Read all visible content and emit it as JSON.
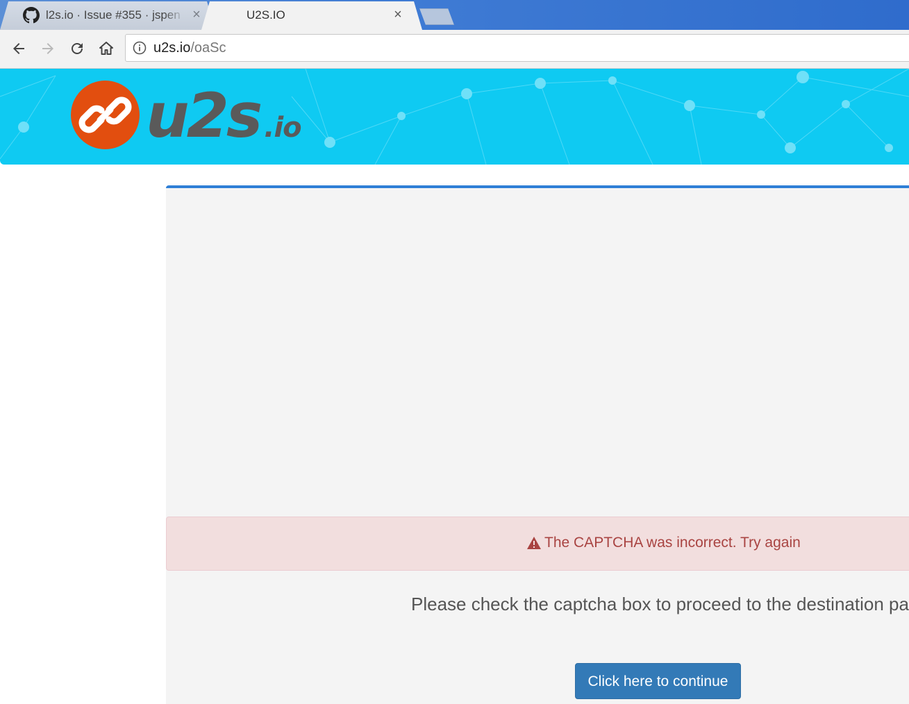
{
  "browser": {
    "tabs": [
      {
        "title": "l2s.io · Issue #355 · jspen",
        "favicon": "github-icon",
        "close": "×",
        "active": false
      },
      {
        "title": "U2S.IO",
        "close": "×",
        "active": true
      }
    ],
    "toolbar": {
      "back": "arrow-left-icon",
      "forward": "arrow-right-icon",
      "reload": "reload-icon",
      "home": "home-icon"
    },
    "address_bar": {
      "host": "u2s.io",
      "path": "/oaSc",
      "icon": "info-icon"
    }
  },
  "site": {
    "logo_main": "u2s",
    "logo_tld": ".io",
    "logo_icon": "chain-link-icon",
    "header_color": "#0fcaf2",
    "logo_color": "#e24e0f"
  },
  "main": {
    "alert": {
      "icon": "warning-triangle-icon",
      "message": "The CAPTCHA was incorrect. Try again"
    },
    "instruction": "Please check the captcha box to proceed to the destination page.",
    "continue_button": "Click here to continue"
  },
  "colors": {
    "accent": "#2f7fd6",
    "button": "#337ab7",
    "alert_text": "#a94442",
    "alert_bg": "#f2dede"
  }
}
